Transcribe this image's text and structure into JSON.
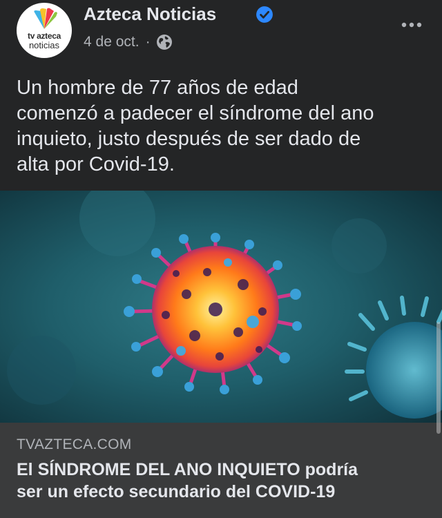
{
  "post": {
    "page_name": "Azteca Noticias",
    "verified": true,
    "date": "4 de oct.",
    "separator": "·",
    "privacy_icon": "globe-icon",
    "more_icon": "more-options-icon",
    "avatar": {
      "logo_line1": "tv azteca",
      "logo_line2": "noticias"
    },
    "text_lines": [
      "Un hombre de 77 años de edad",
      "comenzó a padecer el síndrome del ano",
      "inquieto, justo después de ser dado de",
      "alta por Covid-19."
    ],
    "link": {
      "domain": "TVAZTECA.COM",
      "title_lines": [
        "El SÍNDROME DEL ANO INQUIETO podría",
        "ser un efecto secundario del COVID-19"
      ]
    }
  },
  "colors": {
    "background": "#242526",
    "link_box": "#3a3b3c",
    "verified_badge": "#2d88ff",
    "primary_text": "#e4e6eb",
    "secondary_text": "#b0b3b8"
  }
}
